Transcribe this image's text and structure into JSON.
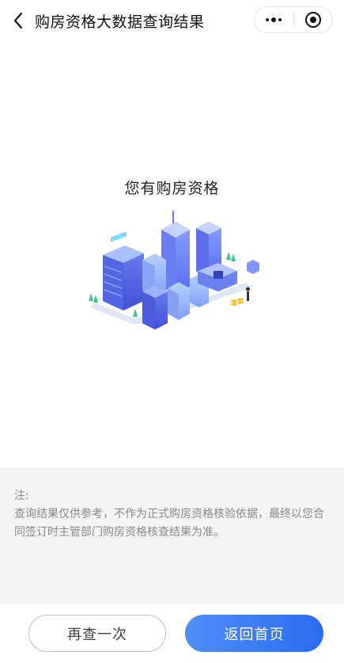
{
  "navbar": {
    "title": "购房资格大数据查询结果",
    "back_icon": "chevron-left-icon",
    "more_icon": "more-dots-icon",
    "close_icon": "target-circle-icon"
  },
  "result": {
    "title": "您有购房资格",
    "illustration": "isometric-city-buildings-illustration"
  },
  "note": {
    "label": "注:",
    "text": "查询结果仅供参考，不作为正式购房资格核验依据，最终以您合同签订时主管部门购房资格核查结果为准。"
  },
  "buttons": {
    "again_label": "再查一次",
    "home_label": "返回首页"
  },
  "colors": {
    "primary": "#2a6cf1",
    "note_bg": "#f3f3f3",
    "note_text": "#8a8a8a"
  }
}
